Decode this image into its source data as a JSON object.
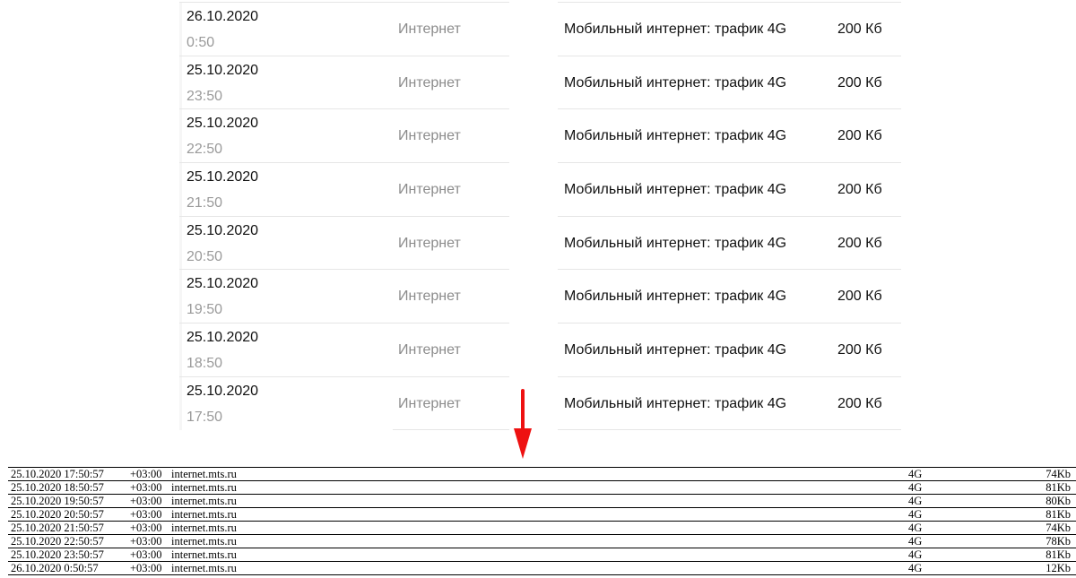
{
  "ui_rows": [
    {
      "date": "26.10.2020",
      "time": "0:50",
      "type": "Интернет",
      "description": "Мобильный интернет: трафик 4G",
      "amount": "200 Кб"
    },
    {
      "date": "25.10.2020",
      "time": "23:50",
      "type": "Интернет",
      "description": "Мобильный интернет: трафик 4G",
      "amount": "200 Кб"
    },
    {
      "date": "25.10.2020",
      "time": "22:50",
      "type": "Интернет",
      "description": "Мобильный интернет: трафик 4G",
      "amount": "200 Кб"
    },
    {
      "date": "25.10.2020",
      "time": "21:50",
      "type": "Интернет",
      "description": "Мобильный интернет: трафик 4G",
      "amount": "200 Кб"
    },
    {
      "date": "25.10.2020",
      "time": "20:50",
      "type": "Интернет",
      "description": "Мобильный интернет: трафик 4G",
      "amount": "200 Кб"
    },
    {
      "date": "25.10.2020",
      "time": "19:50",
      "type": "Интернет",
      "description": "Мобильный интернет: трафик 4G",
      "amount": "200 Кб"
    },
    {
      "date": "25.10.2020",
      "time": "18:50",
      "type": "Интернет",
      "description": "Мобильный интернет: трафик 4G",
      "amount": "200 Кб"
    },
    {
      "date": "25.10.2020",
      "time": "17:50",
      "type": "Интернет",
      "description": "Мобильный интернет: трафик 4G",
      "amount": "200 Кб"
    }
  ],
  "arrow": {
    "color": "#ee1111",
    "icon": "arrow-down-icon"
  },
  "log_rows": [
    {
      "datetime": "25.10.2020 17:50:57",
      "tz": "+03:00",
      "host": "internet.mts.ru",
      "network": "4G",
      "size": "74Kb"
    },
    {
      "datetime": "25.10.2020 18:50:57",
      "tz": "+03:00",
      "host": "internet.mts.ru",
      "network": "4G",
      "size": "81Kb"
    },
    {
      "datetime": "25.10.2020 19:50:57",
      "tz": "+03:00",
      "host": "internet.mts.ru",
      "network": "4G",
      "size": "80Kb"
    },
    {
      "datetime": "25.10.2020 20:50:57",
      "tz": "+03:00",
      "host": "internet.mts.ru",
      "network": "4G",
      "size": "81Kb"
    },
    {
      "datetime": "25.10.2020 21:50:57",
      "tz": "+03:00",
      "host": "internet.mts.ru",
      "network": "4G",
      "size": "74Kb"
    },
    {
      "datetime": "25.10.2020 22:50:57",
      "tz": "+03:00",
      "host": "internet.mts.ru",
      "network": "4G",
      "size": "78Kb"
    },
    {
      "datetime": "25.10.2020 23:50:57",
      "tz": "+03:00",
      "host": "internet.mts.ru",
      "network": "4G",
      "size": "81Kb"
    },
    {
      "datetime": "26.10.2020 0:50:57",
      "tz": "+03:00",
      "host": "internet.mts.ru",
      "network": "4G",
      "size": "12Kb"
    }
  ]
}
